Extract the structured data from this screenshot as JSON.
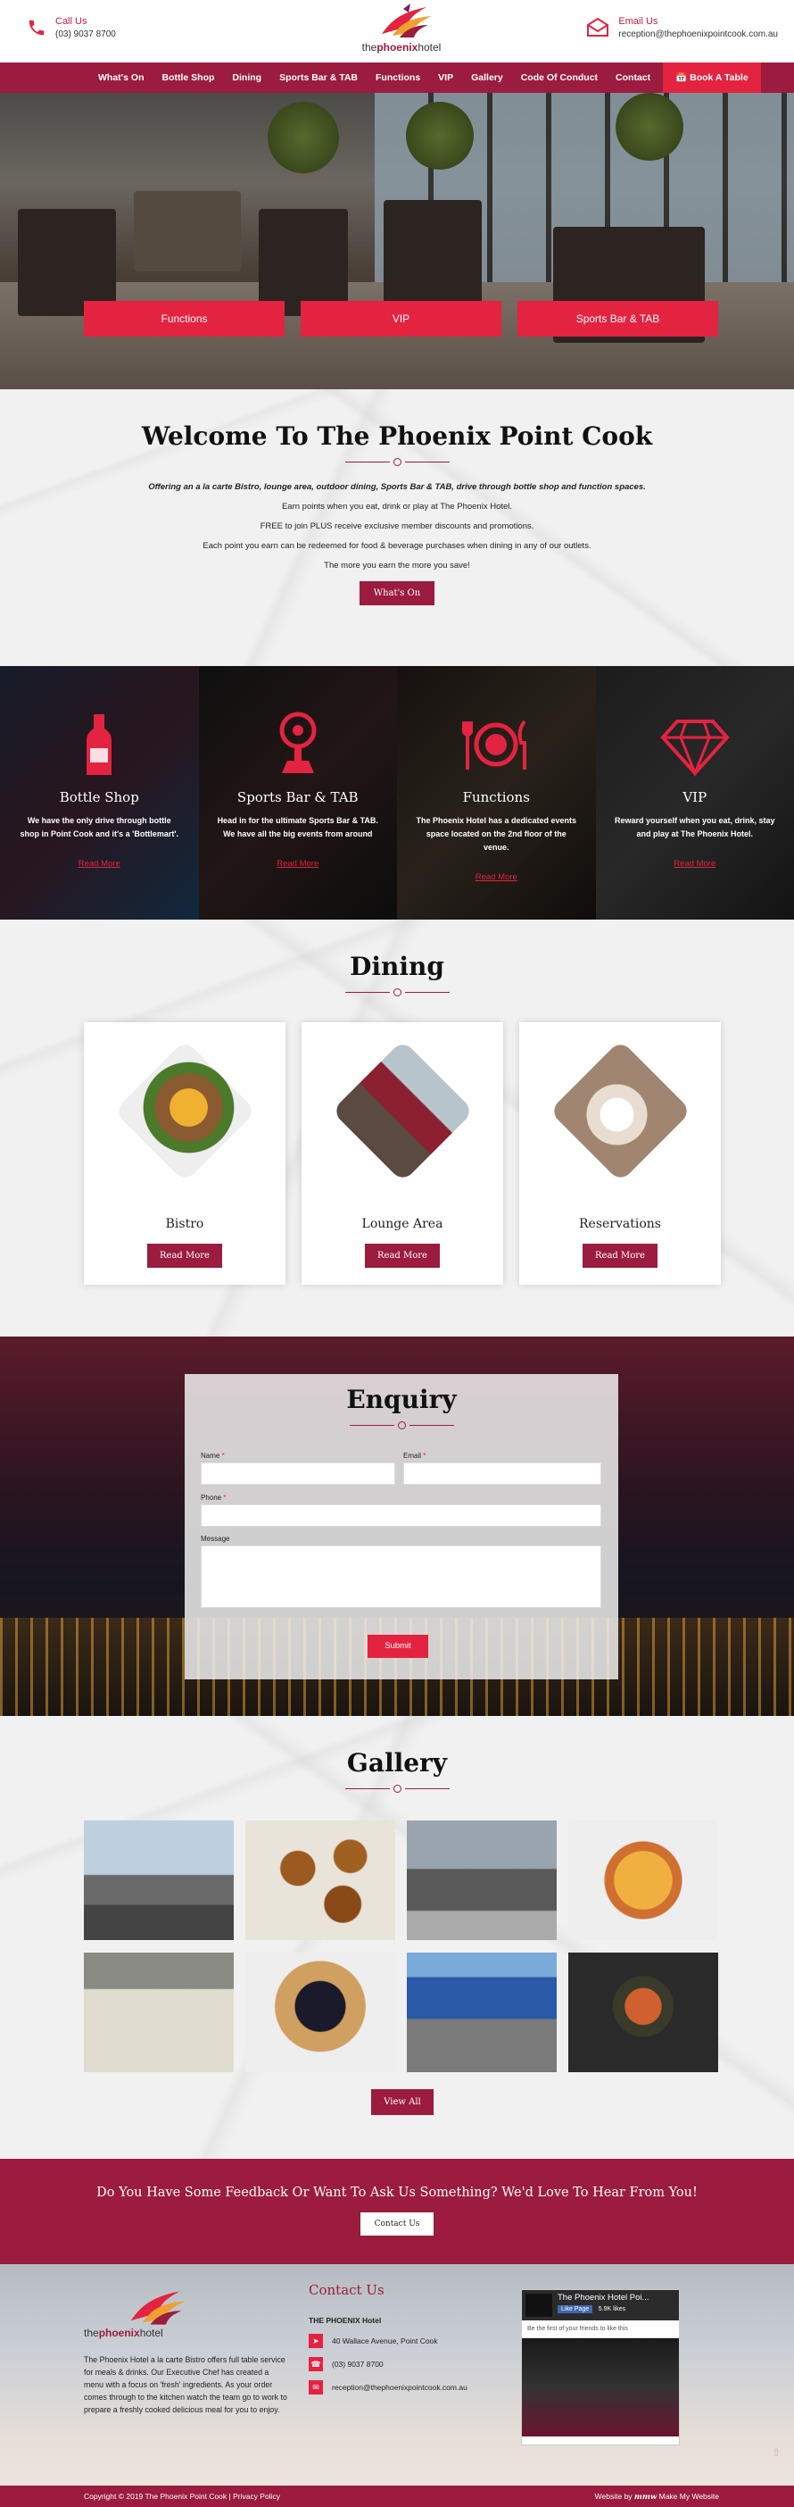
{
  "header": {
    "call_label": "Call Us",
    "call_value": "(03) 9037 8700",
    "email_label": "Email Us",
    "email_value": "reception@thephoenixpointcook.com.au",
    "logo_the": "the",
    "logo_phoenix": "phoenix",
    "logo_hotel": "hotel"
  },
  "nav": {
    "items": [
      "What's On",
      "Bottle Shop",
      "Dining",
      "Sports Bar & TAB",
      "Functions",
      "VIP",
      "Gallery",
      "Code Of Conduct",
      "Contact"
    ],
    "book": "Book A Table"
  },
  "hero": {
    "buttons": [
      "Functions",
      "VIP",
      "Sports Bar & TAB"
    ]
  },
  "welcome": {
    "title": "Welcome To The Phoenix Point Cook",
    "intro": "Offering an a la carte Bistro, lounge area, outdoor dining, Sports Bar & TAB, drive through bottle shop and function spaces.",
    "lines": [
      "Earn points when you eat, drink or play at The Phoenix Hotel.",
      "FREE to join PLUS receive exclusive member discounts and promotions.",
      "Each point you earn can be redeemed for food & beverage purchases when dining in any of our outlets.",
      "The more you earn the more you save!"
    ],
    "button": "What's On"
  },
  "services": [
    {
      "title": "Bottle Shop",
      "text": "We have the only drive through bottle shop in Point Cook and it's a 'Bottlemart'.",
      "link": "Read More",
      "icon": "bottle-icon"
    },
    {
      "title": "Sports Bar & TAB",
      "text": "Head in for the ultimate Sports Bar & TAB. We have all the big events from around",
      "link": "Read More",
      "icon": "trophy-icon"
    },
    {
      "title": "Functions",
      "text": "The Phoenix Hotel has a dedicated events space located on the 2nd floor of the venue.",
      "link": "Read More",
      "icon": "plate-cutlery-icon"
    },
    {
      "title": "VIP",
      "text": "Reward yourself when you eat, drink, stay and play at The Phoenix Hotel.",
      "link": "Read More",
      "icon": "diamond-icon"
    }
  ],
  "dining": {
    "title": "Dining",
    "cards": [
      {
        "title": "Bistro",
        "button": "Read More"
      },
      {
        "title": "Lounge Area",
        "button": "Read More"
      },
      {
        "title": "Reservations",
        "button": "Read More"
      }
    ]
  },
  "enquiry": {
    "title": "Enquiry",
    "name_label": "Name",
    "email_label": "Email",
    "phone_label": "Phone",
    "message_label": "Message",
    "required_mark": "*",
    "submit": "Submit"
  },
  "gallery": {
    "title": "Gallery",
    "button": "View All"
  },
  "feedback": {
    "title": "Do You Have Some Feedback Or Want To Ask Us Something? We'd Love To Hear From You!",
    "button": "Contact Us"
  },
  "footer": {
    "about": "The Phoenix Hotel a la carte Bistro offers full table service for meals & drinks. Our Executive Chef has created a menu with a focus on 'fresh' ingredients. As your order comes through to the kitchen watch the team go to work to prepare a freshly cooked delicious meal for you to enjoy.",
    "contact_title": "Contact Us",
    "contact_name": "THE PHOENIX Hotel",
    "address": "40 Wallace Avenue, Point Cook",
    "phone": "(03) 9037 8700",
    "email": "reception@thephoenixpointcook.com.au",
    "fb_page": "The Phoenix Hotel Poi...",
    "fb_like": "Like Page",
    "fb_likes": "5.9K likes",
    "fb_friends": "Be the first of your friends to like this"
  },
  "bottombar": {
    "copyright": "Copyright © 2019 The Phoenix Point Cook | Privacy Policy",
    "credit": "Website by",
    "credit2": "Make My Website"
  },
  "colors": {
    "brand": "#9b1c3e",
    "accent": "#e32340"
  }
}
